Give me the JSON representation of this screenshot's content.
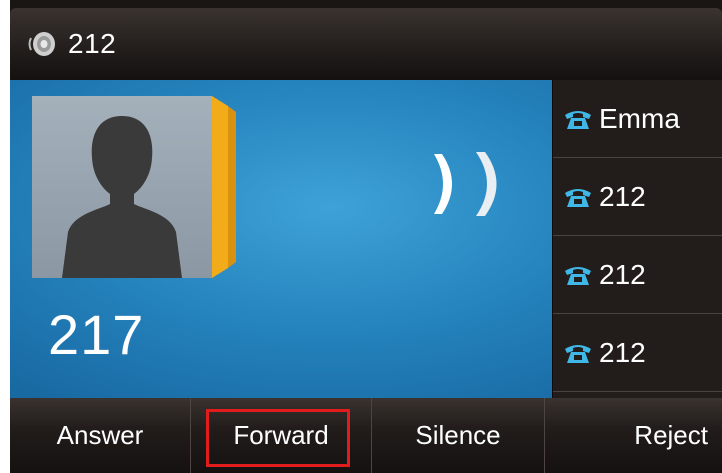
{
  "topbar": {
    "line_number": "212",
    "icon": "speaker-icon"
  },
  "incoming": {
    "caller_number": "217",
    "avatar_icon": "contact-avatar-icon",
    "status_icon": "ringing-icon"
  },
  "call_list": [
    {
      "label": "Emma",
      "icon": "phone-icon"
    },
    {
      "label": "212",
      "icon": "phone-icon"
    },
    {
      "label": "212",
      "icon": "phone-icon"
    },
    {
      "label": "212",
      "icon": "phone-icon"
    }
  ],
  "softkeys": {
    "answer": "Answer",
    "forward": "Forward",
    "silence": "Silence",
    "reject": "Reject"
  },
  "colors": {
    "accent_highlight": "#e21c1c",
    "avatar_tab": "#f4b400",
    "screen_blue": "#2583bd"
  }
}
